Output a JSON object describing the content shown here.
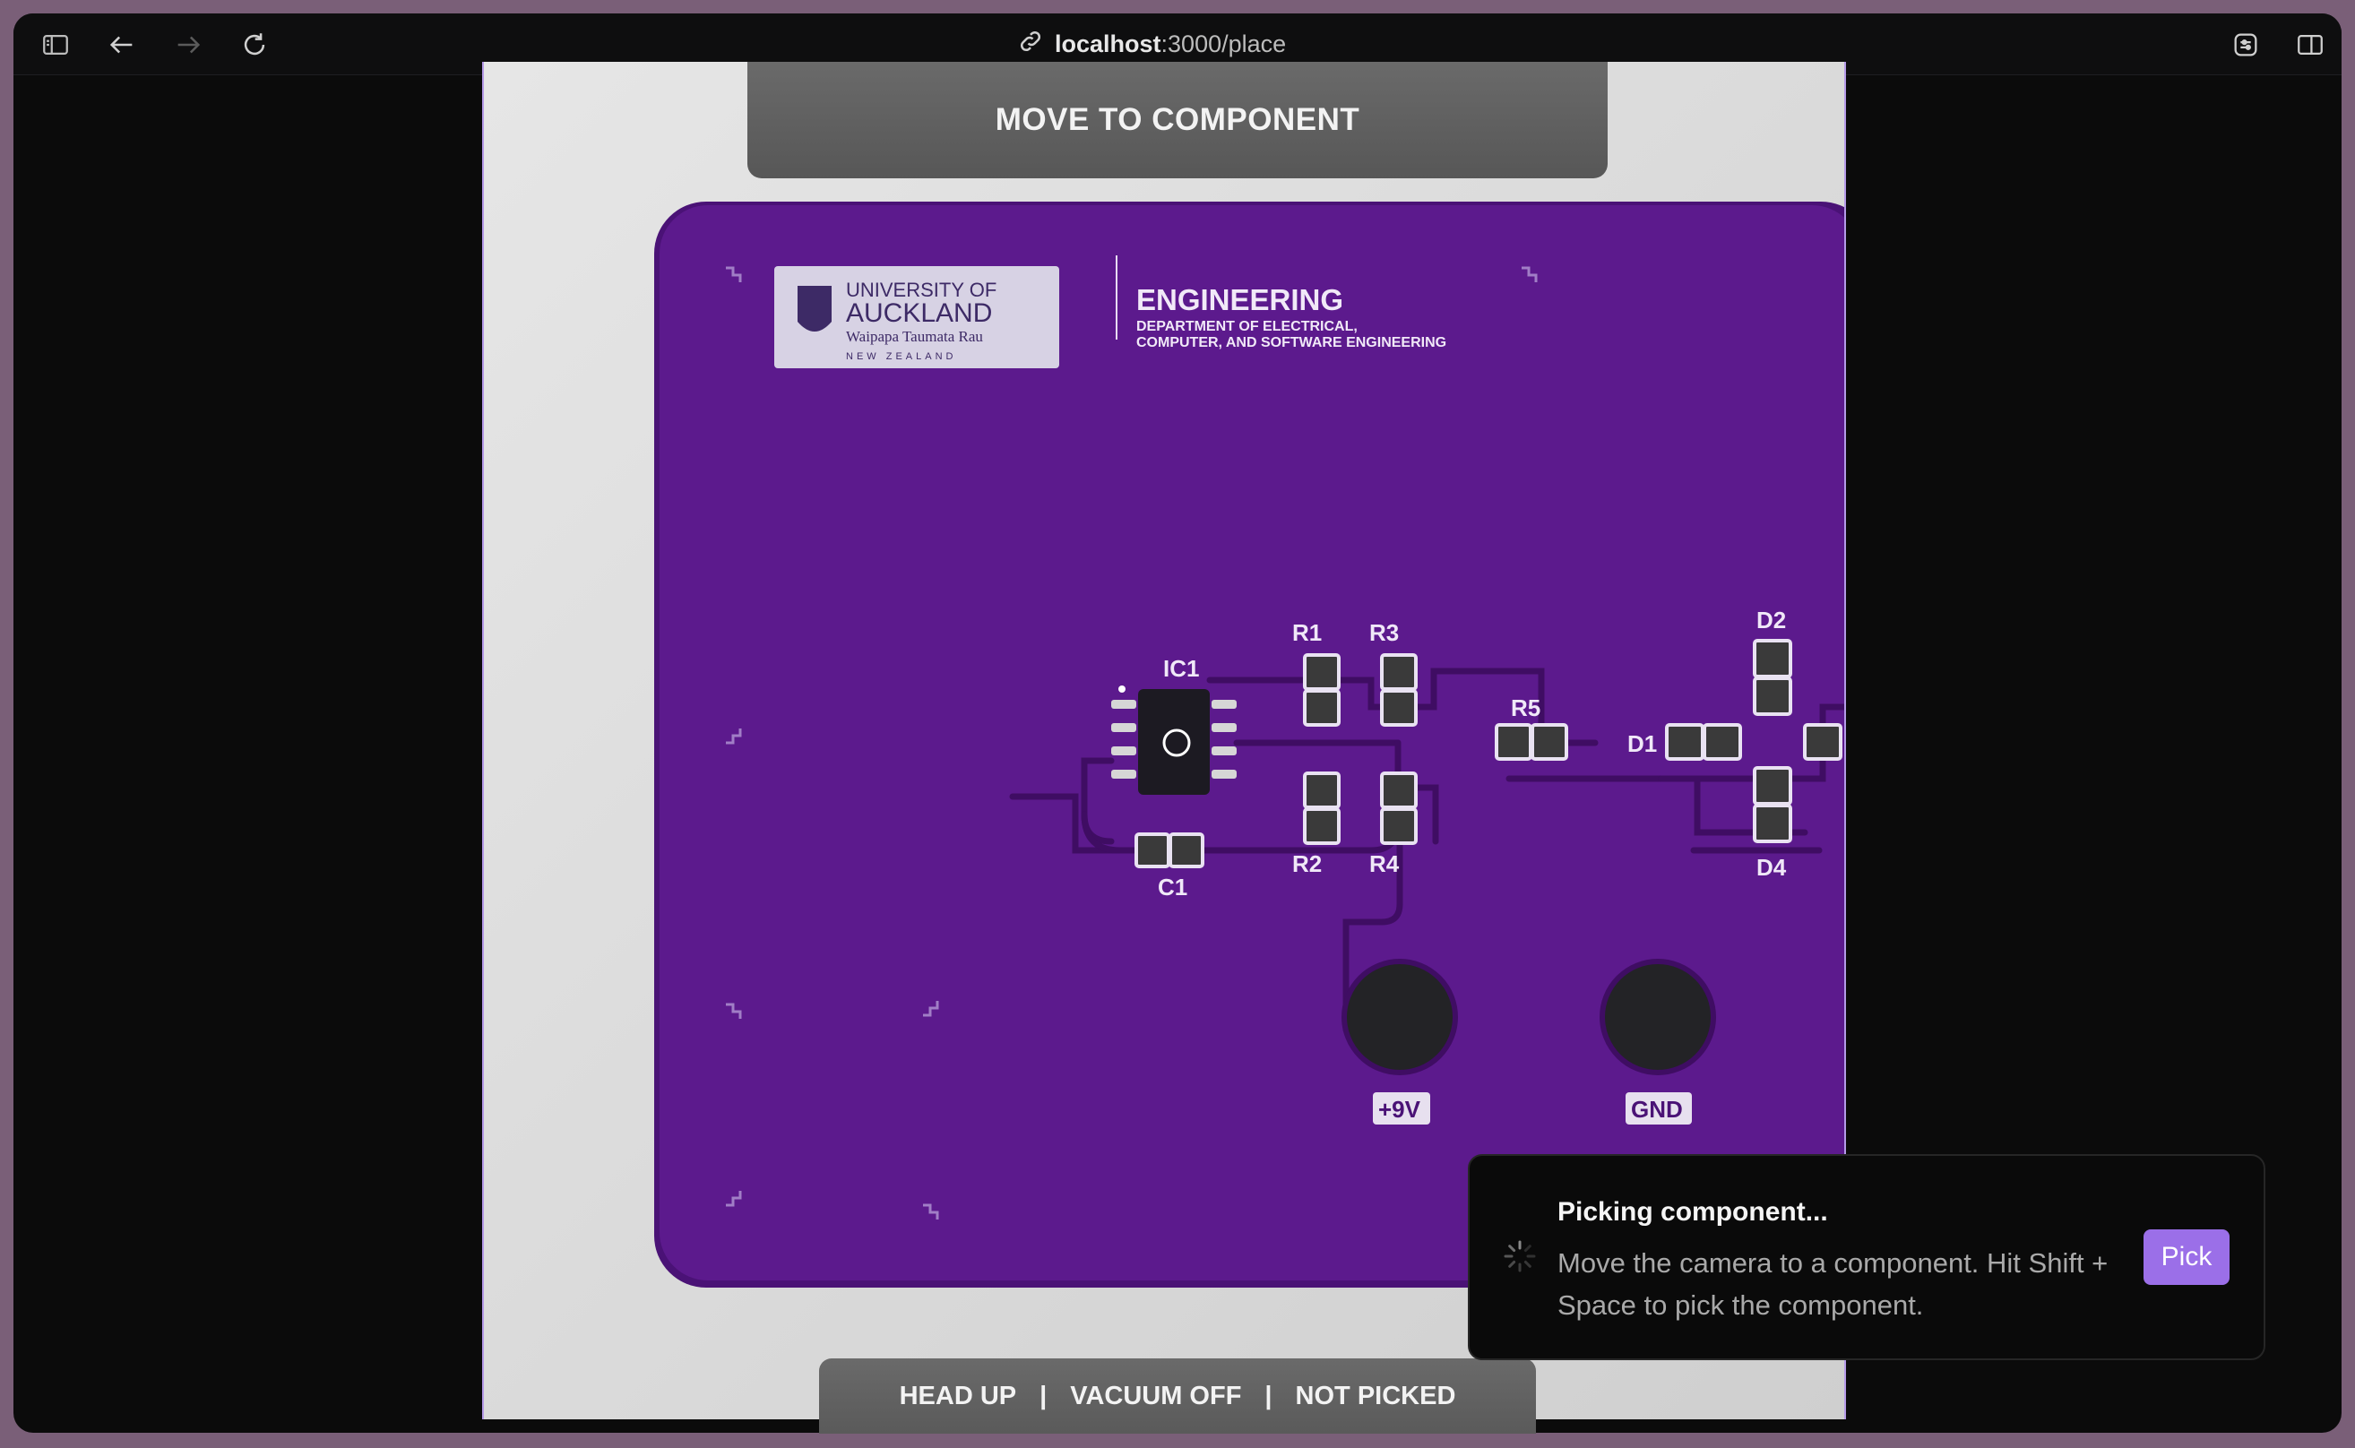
{
  "browser": {
    "url_host": "localhost",
    "url_path": ":3000/place",
    "icons": [
      "sidebar-icon",
      "back-arrow-icon",
      "forward-arrow-icon",
      "reload-icon",
      "link-icon",
      "extensions-icon",
      "split-view-icon"
    ]
  },
  "camera": {
    "banner_text": "MOVE TO COMPONENT",
    "pcb": {
      "logo_line1": "UNIVERSITY OF",
      "logo_line2": "AUCKLAND",
      "logo_line3": "Waipapa Taumata Rau",
      "logo_line4": "NEW ZEALAND",
      "dept_title": "ENGINEERING",
      "dept_line1": "DEPARTMENT OF ELECTRICAL,",
      "dept_line2": "COMPUTER, AND SOFTWARE ENGINEERING",
      "labels": {
        "ic1": "IC1",
        "r1": "R1",
        "r2": "R2",
        "r3": "R3",
        "r4": "R4",
        "r5": "R5",
        "c1": "C1",
        "d1": "D1",
        "d2": "D2",
        "d4": "D4",
        "pos9v": "+9V",
        "gnd": "GND"
      },
      "board_color": "#5a1a8c"
    }
  },
  "status": {
    "head": "HEAD UP",
    "separator": "|",
    "vacuum": "VACUUM OFF",
    "picked": "NOT PICKED"
  },
  "toast": {
    "title": "Picking component...",
    "body": "Move the camera to a component. Hit Shift + Space to pick the component.",
    "button": "Pick",
    "accent": "#9b6fe8"
  }
}
